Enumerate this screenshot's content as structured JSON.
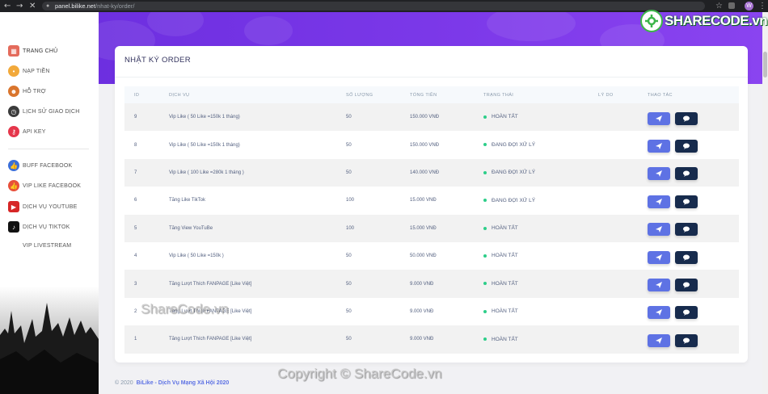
{
  "browser": {
    "url_host": "panel.bilike.net",
    "url_path": "/nhat-ky/order/",
    "avatar_letter": "W"
  },
  "sidebar": {
    "items": [
      {
        "label": "TRANG CHỦ",
        "icon": "calendar-icon",
        "color": "#e46b5b"
      },
      {
        "label": "NẠP TIỀN",
        "icon": "wallet-icon",
        "color": "#f2a93b"
      },
      {
        "label": "HỖ TRỢ",
        "icon": "support-person-icon",
        "color": "#d9752d"
      },
      {
        "label": "LỊCH SỬ GIAO DỊCH",
        "icon": "clock-icon",
        "color": "#3b3b3b"
      },
      {
        "label": "API KEY",
        "icon": "key-icon",
        "color": "#e5364b"
      },
      {
        "label": "BUFF FACEBOOK",
        "icon": "like-icon",
        "color": "#3b6fd8"
      },
      {
        "label": "VIP LIKE FACEBOOK",
        "icon": "like-icon",
        "color": "#e8503a"
      },
      {
        "label": "DỊCH VỤ YOUTUBE",
        "icon": "youtube-icon",
        "color": "#d62626"
      },
      {
        "label": "DỊCH VỤ TIKTOK",
        "icon": "tiktok-icon",
        "color": "#111111"
      },
      {
        "label": "VIP LIVESTREAM",
        "icon": "",
        "color": ""
      }
    ]
  },
  "card": {
    "title": "NHẬT KÝ ORDER",
    "columns": [
      "ID",
      "DỊCH VỤ",
      "SỐ LƯỢNG",
      "TỔNG TIỀN",
      "TRẠNG THÁI",
      "LÝ DO",
      "THAO TÁC"
    ],
    "rows": [
      {
        "id": "9",
        "service": "Vip Like ( 50 Like =150k 1 tháng)",
        "qty": "50",
        "total": "150.000 VNĐ",
        "status": "HOÀN TẤT",
        "reason": ""
      },
      {
        "id": "8",
        "service": "Vip Like ( 50 Like =150k 1 tháng)",
        "qty": "50",
        "total": "150.000 VNĐ",
        "status": "ĐANG ĐỢI XỬ LÝ",
        "reason": ""
      },
      {
        "id": "7",
        "service": "Vip Like ( 100 Like =280k 1 tháng )",
        "qty": "50",
        "total": "140.000 VNĐ",
        "status": "ĐANG ĐỢI XỬ LÝ",
        "reason": ""
      },
      {
        "id": "6",
        "service": "Tăng Like TikTok",
        "qty": "100",
        "total": "15.000 VNĐ",
        "status": "ĐANG ĐỢI XỬ LÝ",
        "reason": ""
      },
      {
        "id": "5",
        "service": "Tăng View YouTuBe",
        "qty": "100",
        "total": "15.000 VNĐ",
        "status": "HOÀN TẤT",
        "reason": ""
      },
      {
        "id": "4",
        "service": "Vip Like ( 50 Like =150k )",
        "qty": "50",
        "total": "50.000 VNĐ",
        "status": "HOÀN TẤT",
        "reason": ""
      },
      {
        "id": "3",
        "service": "Tăng Lượt Thích FANPAGE [Like Việt]",
        "qty": "50",
        "total": "9.000 VNĐ",
        "status": "HOÀN TẤT",
        "reason": ""
      },
      {
        "id": "2",
        "service": "Tăng Lượt Thích FANPAGE [Like Việt]",
        "qty": "50",
        "total": "9.000 VNĐ",
        "status": "HOÀN TẤT",
        "reason": ""
      },
      {
        "id": "1",
        "service": "Tăng Lượt Thích FANPAGE [Like Việt]",
        "qty": "50",
        "total": "9.000 VNĐ",
        "status": "HOÀN TẤT",
        "reason": ""
      }
    ]
  },
  "footer": {
    "year": "© 2020",
    "brand": "BiLike - Dịch Vụ Mạng Xã Hội 2020"
  },
  "watermarks": {
    "logo_main": "SHARE",
    "logo_accent": "CODE.vn",
    "middle": "ShareCode.vn",
    "bottom": "Copyright © ShareCode.vn"
  },
  "colors": {
    "banner": "#7b38e8",
    "status_dot": "#2dce89",
    "send_button": "#5e72e4",
    "chat_button": "#172b4d"
  }
}
